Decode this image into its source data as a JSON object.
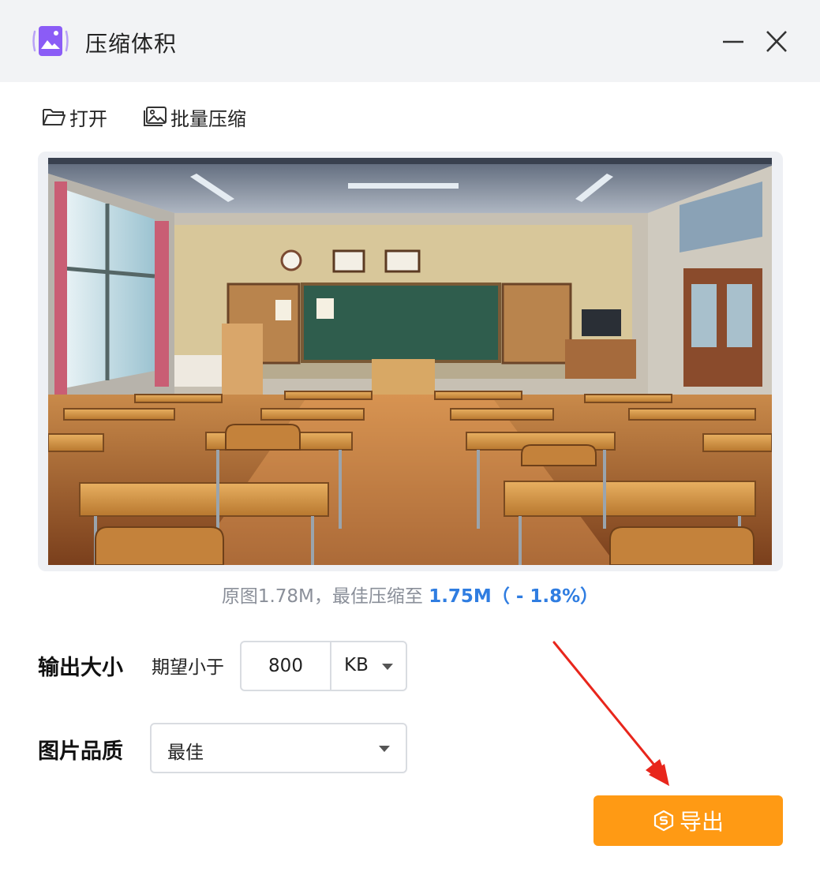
{
  "window": {
    "title": "压缩体积",
    "app_icon": "image-compress-app-icon",
    "minimize_icon": "minimize-icon",
    "close_icon": "close-icon"
  },
  "toolbar": {
    "open_label": "打开",
    "open_icon": "folder-open-icon",
    "batch_label": "批量压缩",
    "batch_icon": "image-icon"
  },
  "preview": {
    "image": "classroom-illustration"
  },
  "compress_info": {
    "original_prefix": "原图1.78M，最佳压缩至",
    "result": "1.75M（ - 1.8%）"
  },
  "output_size": {
    "label": "输出大小",
    "expect_label": "期望小于",
    "value": "800",
    "unit": "KB"
  },
  "quality": {
    "label": "图片品质",
    "selected": "最佳"
  },
  "export": {
    "label": "导出",
    "icon": "export-coin-icon"
  },
  "colors": {
    "accent_orange": "#ff9a14",
    "highlight_blue": "#2f7de1",
    "app_purple": "#8b5cf6",
    "annotation_red": "#e8261c"
  }
}
